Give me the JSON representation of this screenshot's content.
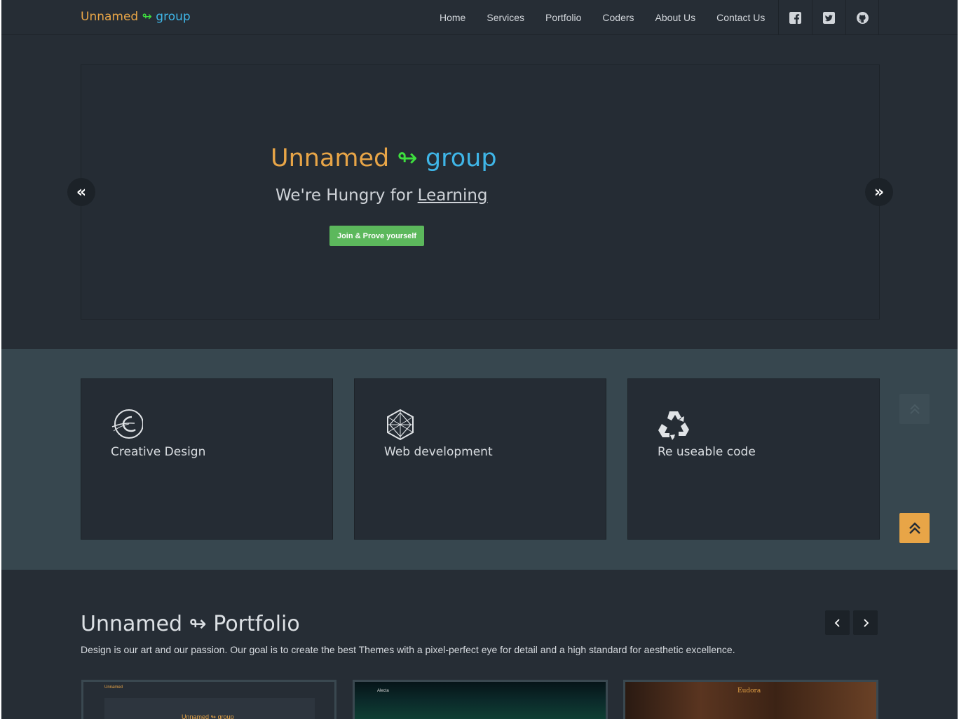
{
  "brand": {
    "word1": "Unnamed",
    "arrow": "↬",
    "word2": "group"
  },
  "nav": {
    "items": [
      "Home",
      "Services",
      "Portfolio",
      "Coders",
      "About Us",
      "Contact Us"
    ],
    "social": [
      "facebook-icon",
      "twitter-icon",
      "github-icon"
    ]
  },
  "hero": {
    "title_word1": "Unnamed",
    "title_arrow": "↬",
    "title_word2": "group",
    "subtitle_plain": "We're Hungry for ",
    "subtitle_underlined": "Learning",
    "cta": "Join & Prove yourself",
    "prev": "«",
    "next": "»"
  },
  "services": {
    "items": [
      {
        "label": "Creative Design",
        "icon": "creative-design-icon"
      },
      {
        "label": "Web development",
        "icon": "web-development-icon"
      },
      {
        "label": "Re useable code",
        "icon": "recycle-icon"
      }
    ]
  },
  "portfolio": {
    "title": "Unnamed ↬ Portfolio",
    "description": "Design is our art and our passion. Our goal is to create the best Themes with a pixel-perfect eye for detail and a high standard for aesthetic excellence.",
    "thumbs": [
      {
        "caption": "Unnamed ↬ group"
      },
      {
        "caption": "Alecta"
      },
      {
        "caption": "Eudora"
      }
    ]
  },
  "colors": {
    "accent_orange": "#e8a547",
    "accent_green": "#3ee03e",
    "accent_blue": "#3fb6e8",
    "button_green": "#5cb85c",
    "bg_dark": "#262d35",
    "bg_band": "#37474f"
  }
}
